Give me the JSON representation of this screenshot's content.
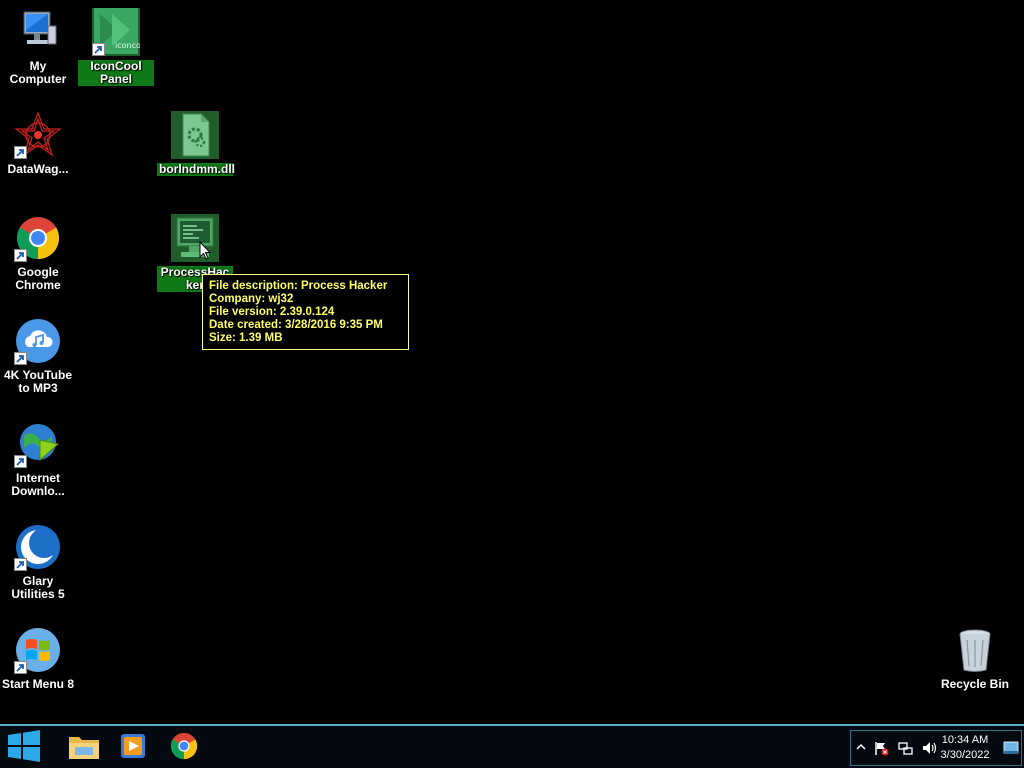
{
  "desktop": {
    "icons": [
      {
        "label": "My Computer",
        "name": "my-computer-icon"
      },
      {
        "label": "IconCool Panel",
        "name": "iconcool-panel-icon"
      },
      {
        "label": "DataWag...",
        "name": "datawag-icon"
      },
      {
        "label": "borlndmm.dll",
        "name": "borlndmm-dll-icon"
      },
      {
        "label": "Google Chrome",
        "name": "google-chrome-icon"
      },
      {
        "label": "ProcessHac ker",
        "name": "processhacker-icon"
      },
      {
        "label": "4K YouTube to MP3",
        "name": "4k-youtube-to-mp3-icon"
      },
      {
        "label": "Internet Downlo...",
        "name": "internet-download-manager-icon"
      },
      {
        "label": "Glary Utilities 5",
        "name": "glary-utilities-icon"
      },
      {
        "label": "Start Menu 8",
        "name": "start-menu-8-icon"
      },
      {
        "label": "Recycle Bin",
        "name": "recycle-bin-icon"
      }
    ],
    "iconcool_tile_text": "iconcool"
  },
  "tooltip": {
    "lines": [
      "File description: Process Hacker",
      "Company: wj32",
      "File version: 2.39.0.124",
      "Date created: 3/28/2016 9:35 PM",
      "Size: 1.39 MB"
    ]
  },
  "taskbar": {
    "pinned": [
      "windows-start-icon",
      "file-explorer-icon",
      "media-player-icon",
      "chrome-icon"
    ],
    "tray_icons": [
      "chevron-up-icon",
      "action-center-flag-icon",
      "network-icon",
      "volume-icon",
      "show-desktop-icon"
    ],
    "clock": {
      "time": "10:34 AM",
      "date": "3/30/2022"
    }
  },
  "colors": {
    "selection": "#0f7a17",
    "tooltip_text": "#ffff66",
    "taskbar_accent": "#4fb0c8"
  }
}
